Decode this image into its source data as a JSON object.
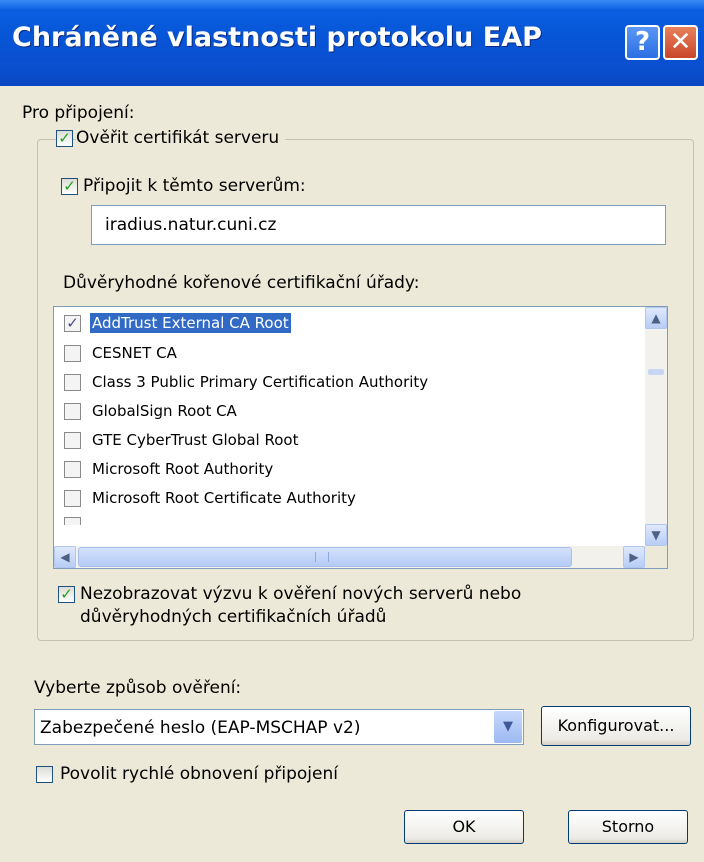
{
  "window": {
    "title": "Chráněné vlastnosti protokolu EAP",
    "help_label": "?",
    "close_label": "✕"
  },
  "connect_label": "Pro připojení:",
  "verify_cert": {
    "label": "Ověřit certifikát serveru",
    "checked": true
  },
  "connect_servers": {
    "label": "Připojit k těmto serverům:",
    "checked": true,
    "value": "iradius.natur.cuni.cz"
  },
  "trusted_ca_label": "Důvěryhodné kořenové certifikační úřady:",
  "ca_list": [
    {
      "label": "AddTrust External CA Root",
      "checked": true,
      "selected": true
    },
    {
      "label": "CESNET CA",
      "checked": false,
      "selected": false
    },
    {
      "label": "Class 3 Public Primary Certification Authority",
      "checked": false,
      "selected": false
    },
    {
      "label": "GlobalSign Root CA",
      "checked": false,
      "selected": false
    },
    {
      "label": "GTE CyberTrust Global Root",
      "checked": false,
      "selected": false
    },
    {
      "label": "Microsoft Root Authority",
      "checked": false,
      "selected": false
    },
    {
      "label": "Microsoft Root Certificate Authority",
      "checked": false,
      "selected": false
    }
  ],
  "no_prompt": {
    "line1": "Nezobrazovat výzvu k ověření nových serverů nebo",
    "line2": "důvěryhodných certifikačních úřadů",
    "checked": true
  },
  "auth_method_label": "Vyberte způsob ověření:",
  "auth_method_value": "Zabezpečené heslo (EAP-MSCHAP v2)",
  "configure_label": "Konfigurovat...",
  "fast_reconnect": {
    "label": "Povolit rychlé obnovení připojení",
    "checked": false
  },
  "ok_label": "OK",
  "cancel_label": "Storno",
  "icons": {
    "check": "checkmark-icon",
    "scroll_up": "chevron-up-icon",
    "scroll_down": "chevron-down-icon",
    "scroll_left": "chevron-left-icon",
    "scroll_right": "chevron-right-icon"
  },
  "colors": {
    "titlebar": "#0754d6",
    "selection": "#316ac5",
    "dialog_bg": "#ece9d8"
  }
}
